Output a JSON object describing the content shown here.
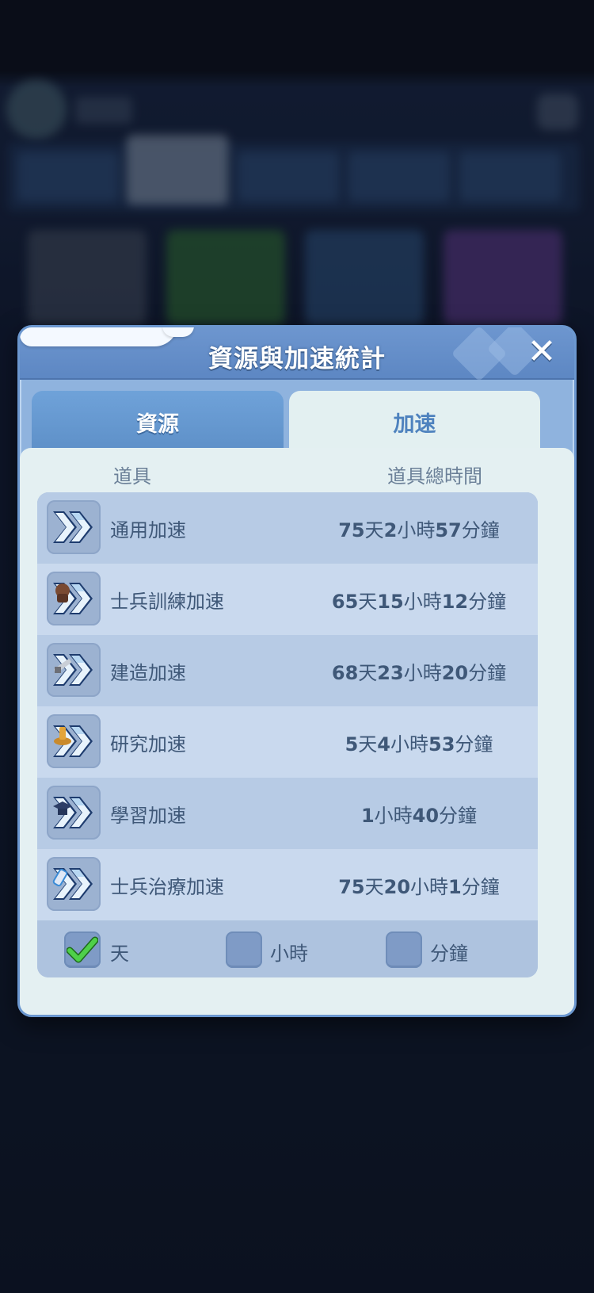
{
  "dialog": {
    "title": "資源與加速統計",
    "close_icon": "close-icon",
    "tabs": [
      {
        "label": "資源",
        "selected": false
      },
      {
        "label": "加速",
        "selected": true
      }
    ],
    "columns": {
      "item": "道具",
      "total_time": "道具總時間"
    },
    "rows": [
      {
        "label": "通用加速",
        "time": [
          {
            "n": "75",
            "u": "天"
          },
          {
            "n": "2",
            "u": "小時"
          },
          {
            "n": "57",
            "u": "分鐘"
          }
        ],
        "icon": "speedup-general-icon"
      },
      {
        "label": "士兵訓練加速",
        "time": [
          {
            "n": "65",
            "u": "天"
          },
          {
            "n": "15",
            "u": "小時"
          },
          {
            "n": "12",
            "u": "分鐘"
          }
        ],
        "icon": "speedup-training-icon"
      },
      {
        "label": "建造加速",
        "time": [
          {
            "n": "68",
            "u": "天"
          },
          {
            "n": "23",
            "u": "小時"
          },
          {
            "n": "20",
            "u": "分鐘"
          }
        ],
        "icon": "speedup-building-icon"
      },
      {
        "label": "研究加速",
        "time": [
          {
            "n": "5",
            "u": "天"
          },
          {
            "n": "4",
            "u": "小時"
          },
          {
            "n": "53",
            "u": "分鐘"
          }
        ],
        "icon": "speedup-research-icon"
      },
      {
        "label": "學習加速",
        "time": [
          {
            "n": "1",
            "u": "小時"
          },
          {
            "n": "40",
            "u": "分鐘"
          }
        ],
        "icon": "speedup-learning-icon"
      },
      {
        "label": "士兵治療加速",
        "time": [
          {
            "n": "75",
            "u": "天"
          },
          {
            "n": "20",
            "u": "小時"
          },
          {
            "n": "1",
            "u": "分鐘"
          }
        ],
        "icon": "speedup-healing-icon"
      }
    ],
    "units": [
      {
        "label": "天",
        "checked": true
      },
      {
        "label": "小時",
        "checked": false
      },
      {
        "label": "分鐘",
        "checked": false
      }
    ]
  },
  "colors": {
    "header": "#6d96cf",
    "panel": "#e4f0f2",
    "row_odd": "#b7cbe5",
    "row_even": "#c9d9ee",
    "text": "#3f5878",
    "check_green": "#3cc43a"
  }
}
